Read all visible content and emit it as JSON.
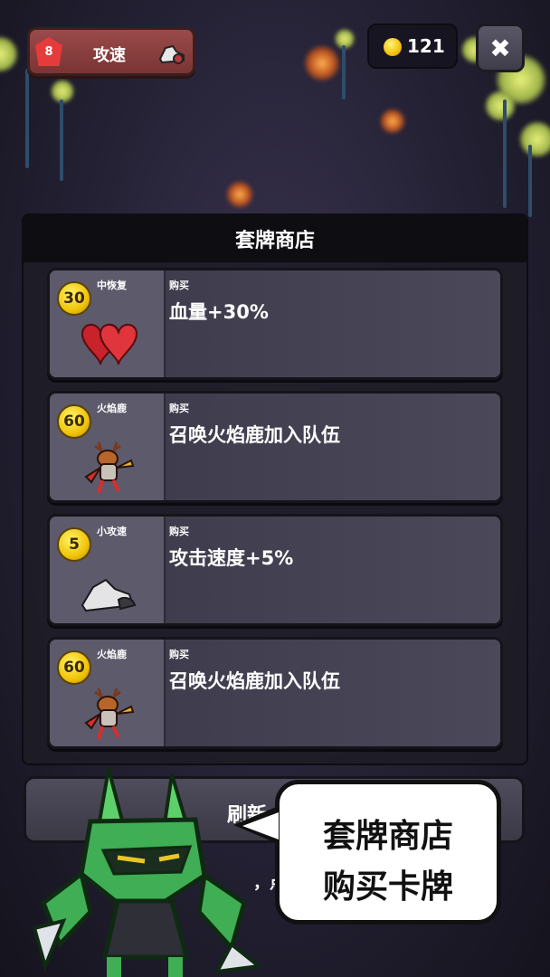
{
  "top_bar": {
    "stat_level": "8",
    "stat_label": "攻速",
    "stat_icon": "sneaker-icon",
    "coins": "121",
    "close_label": "✖"
  },
  "shop": {
    "title": "套牌商店",
    "cards": [
      {
        "price": "30",
        "name": "中恢复",
        "buy": "购买",
        "desc": "血量+30%",
        "icon": "hearts-icon"
      },
      {
        "price": "60",
        "name": "火焰鹿",
        "buy": "购买",
        "desc": "召唤火焰鹿加入队伍",
        "icon": "fire-deer-icon"
      },
      {
        "price": "5",
        "name": "小攻速",
        "buy": "购买",
        "desc": "攻击速度+5%",
        "icon": "sneaker-icon"
      },
      {
        "price": "60",
        "name": "火焰鹿",
        "buy": "购买",
        "desc": "召唤火焰鹿加入队伍",
        "icon": "fire-deer-icon"
      }
    ],
    "refresh_label": "刷新",
    "hint_partial": "，点"
  },
  "bubble": {
    "line1": "套牌商店",
    "line2": "购买卡牌"
  },
  "colors": {
    "accent_gold": "#f2c20c",
    "chip_red": "#9a4a4a",
    "card_bg": "#4a4859"
  }
}
